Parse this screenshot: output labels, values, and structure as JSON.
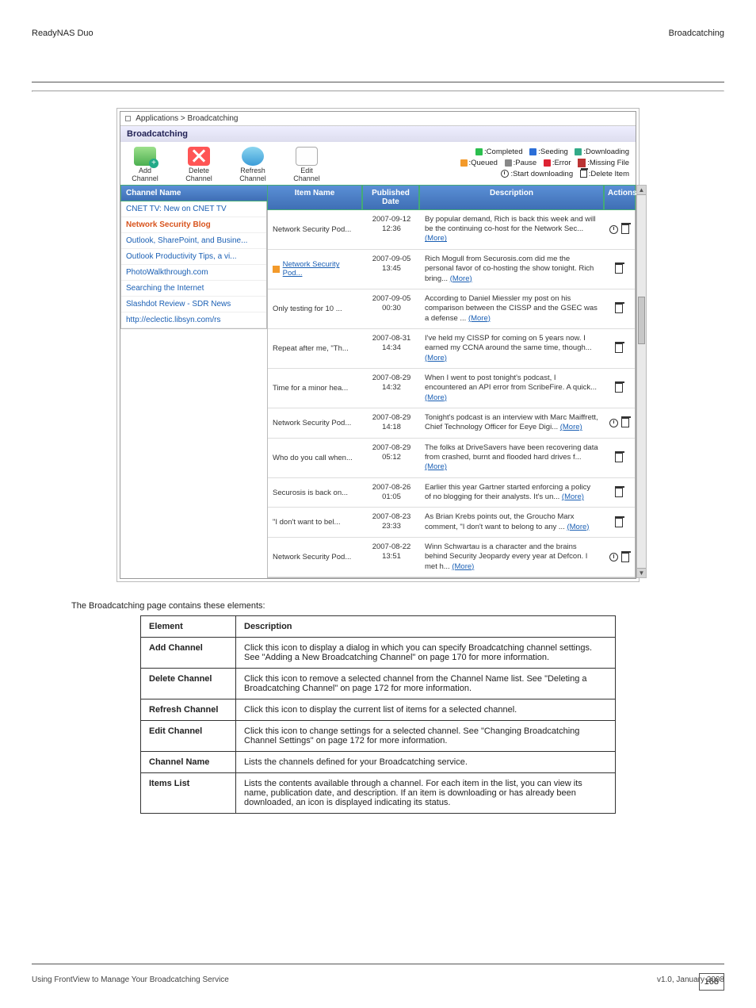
{
  "doc": {
    "header_title": "ReadyNAS Duo",
    "header_right": "Broadcatching",
    "page_number": "168",
    "footer_left": "Using FrontView to Manage Your Broadcatching Service",
    "footer_right": "v1.0, January 2008"
  },
  "window": {
    "breadcrumb": "Applications  >  Broadcatching",
    "title": "Broadcatching"
  },
  "toolbar": {
    "add": "Add Channel",
    "delete": "Delete Channel",
    "refresh": "Refresh Channel",
    "edit": "Edit Channel"
  },
  "legend": {
    "completed": ":Completed",
    "seeding": ":Seeding",
    "downloading": ":Downloading",
    "queued": ":Queued",
    "pause": ":Pause",
    "error": ":Error",
    "missing": ":Missing File",
    "start": ":Start downloading",
    "delete_item": ":Delete Item"
  },
  "headers": {
    "channel": "Channel Name",
    "item": "Item Name",
    "date": "Published Date",
    "desc": "Description",
    "actions": "Actions"
  },
  "channels": [
    {
      "label": "CNET TV: New on CNET TV",
      "sel": false
    },
    {
      "label": "Network Security Blog",
      "sel": true
    },
    {
      "label": "Outlook, SharePoint, and Busine...",
      "sel": false
    },
    {
      "label": "Outlook Productivity Tips, a vi...",
      "sel": false
    },
    {
      "label": "PhotoWalkthrough.com",
      "sel": false
    },
    {
      "label": "Searching the Internet",
      "sel": false
    },
    {
      "label": "Slashdot Review - SDR News",
      "sel": false
    },
    {
      "label": "http://eclectic.libsyn.com/rs",
      "sel": false
    }
  ],
  "items": [
    {
      "name": "Network Security Pod...",
      "link": false,
      "queued": false,
      "date1": "2007-09-12",
      "date2": "12:36",
      "desc": "By popular demand, Rich is back this week and will be the continuing co-host for the Network Sec... ",
      "more": "(More)",
      "clock": true
    },
    {
      "name": "Network Security Pod...",
      "link": true,
      "queued": true,
      "date1": "2007-09-05",
      "date2": "13:45",
      "desc": "Rich Mogull from Securosis.com did me the personal favor of co-hosting the show tonight. Rich bring... ",
      "more": "(More)",
      "clock": false
    },
    {
      "name": "Only testing for 10 ...",
      "link": false,
      "queued": false,
      "date1": "2007-09-05",
      "date2": "00:30",
      "desc": "According to Daniel Miessler my post on his comparison between the CISSP and the GSEC was a defense ... ",
      "more": "(More)",
      "clock": false
    },
    {
      "name": "Repeat after me, \"Th...",
      "link": false,
      "queued": false,
      "date1": "2007-08-31",
      "date2": "14:34",
      "desc": "I've held my CISSP for coming on 5 years now. I earned my CCNA around the same time, though... ",
      "more": "(More)",
      "clock": false
    },
    {
      "name": "Time for a minor hea...",
      "link": false,
      "queued": false,
      "date1": "2007-08-29",
      "date2": "14:32",
      "desc": "When I went to post tonight's podcast, I encountered an API error from ScribeFire. A quick... ",
      "more": "(More)",
      "clock": false
    },
    {
      "name": "Network Security Pod...",
      "link": false,
      "queued": false,
      "date1": "2007-08-29",
      "date2": "14:18",
      "desc": "Tonight's podcast is an interview with Marc Maiffrett, Chief Technology Officer for Eeye Digi... ",
      "more": "(More)",
      "clock": true
    },
    {
      "name": "Who do you call when...",
      "link": false,
      "queued": false,
      "date1": "2007-08-29",
      "date2": "05:12",
      "desc": "The folks at DriveSavers have been recovering data from crashed, burnt and flooded hard drives f... ",
      "more": "(More)",
      "clock": false
    },
    {
      "name": "Securosis is back on...",
      "link": false,
      "queued": false,
      "date1": "2007-08-26",
      "date2": "01:05",
      "desc": "Earlier this year Gartner started enforcing a policy of no blogging for their analysts. It's un... ",
      "more": "(More)",
      "clock": false
    },
    {
      "name": "\"I don't want to bel...",
      "link": false,
      "queued": false,
      "date1": "2007-08-23",
      "date2": "23:33",
      "desc": "As Brian Krebs points out, the Groucho Marx comment, \"I don't want to belong to any ... ",
      "more": "(More)",
      "clock": false
    },
    {
      "name": "Network Security Pod...",
      "link": false,
      "queued": false,
      "date1": "2007-08-22",
      "date2": "13:51",
      "desc": "Winn Schwartau is a character and the brains behind Security Jeopardy every year at Defcon. I met h... ",
      "more": "(More)",
      "clock": true
    }
  ],
  "elements_heading": "The Broadcatching page contains these elements:",
  "elements": [
    {
      "label": "Element",
      "desc": "Description",
      "hdr": true
    },
    {
      "label": "Add Channel",
      "desc": "Click this icon to display a dialog in which you can specify Broadcatching channel settings. See \"Adding a New Broadcatching Channel\" on page 170 for more information."
    },
    {
      "label": "Delete Channel",
      "desc": "Click this icon to remove a selected channel from the Channel Name list. See \"Deleting a Broadcatching Channel\" on page 172 for more information."
    },
    {
      "label": "Refresh Channel",
      "desc": "Click this icon to display the current list of items for a selected channel."
    },
    {
      "label": "Edit Channel",
      "desc": "Click this icon to change settings for a selected channel. See \"Changing Broadcatching Channel Settings\" on page 172 for more information."
    },
    {
      "label": "Channel Name",
      "desc": "Lists the channels defined for your Broadcatching service."
    },
    {
      "label": "Items List",
      "desc": "Lists the contents available through a channel. For each item in the list, you can view its name, publication date, and description. If an item is downloading or has already been downloaded, an icon is displayed indicating its status."
    }
  ]
}
